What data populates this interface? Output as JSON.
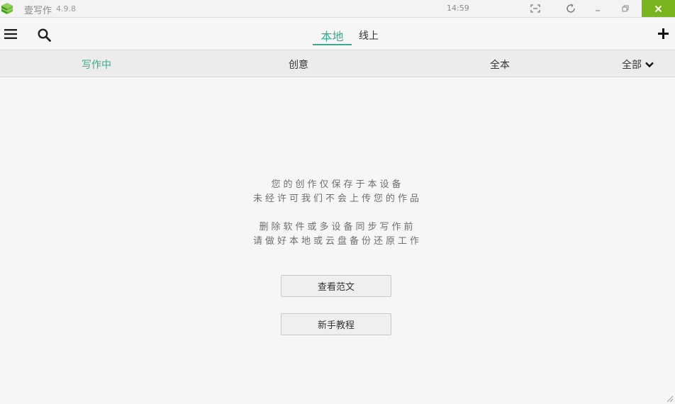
{
  "titlebar": {
    "app_name": "壹写作",
    "version": "4.9.8",
    "clock": "14:59"
  },
  "toolbar": {
    "tabs": [
      {
        "label": "本地",
        "active": true
      },
      {
        "label": "线上",
        "active": false
      }
    ]
  },
  "filters": {
    "items": [
      {
        "label": "写作中",
        "active": true
      },
      {
        "label": "创意",
        "active": false
      },
      {
        "label": "全本",
        "active": false
      }
    ],
    "dropdown_label": "全部"
  },
  "message": {
    "line1": "您的创作仅保存于本设备",
    "line2": "未经许可我们不会上传您的作品",
    "line3": "删除软件或多设备同步写作前",
    "line4": "请做好本地或云盘备份还原工作"
  },
  "buttons": {
    "view_samples": "查看范文",
    "tutorial": "新手教程"
  },
  "colors": {
    "accent": "#3aa98c",
    "close_button": "#79b31d",
    "background": "#f6f6f6"
  },
  "icons": {
    "menu": "menu-icon",
    "search": "search-icon",
    "add": "plus-icon",
    "fullscreen": "fullscreen-icon",
    "refresh": "refresh-icon",
    "minimize": "minimize-icon",
    "restore": "restore-icon",
    "close": "close-icon",
    "dropdown": "chevron-down-icon"
  }
}
